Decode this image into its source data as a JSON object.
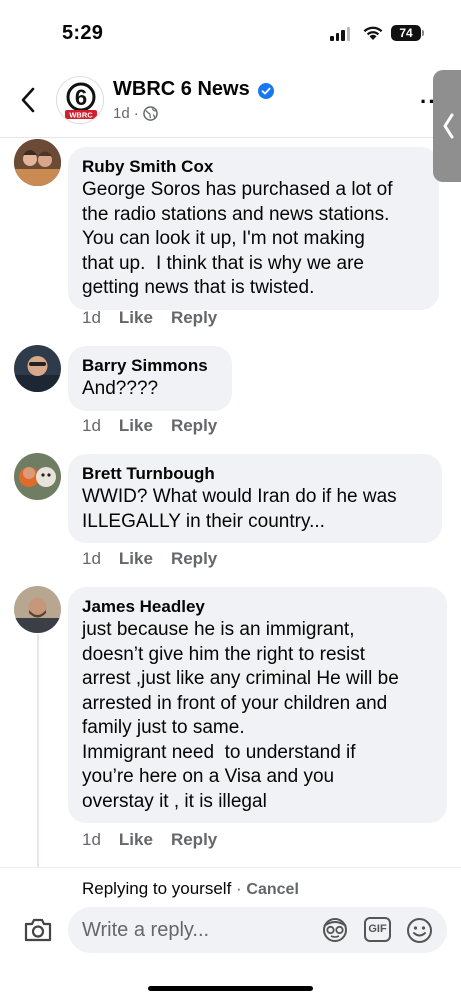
{
  "status": {
    "time": "5:29",
    "battery": "74"
  },
  "header": {
    "page_name": "WBRC 6 News",
    "meta_time": "1d",
    "meta_sep": "·",
    "logo_text": "WBRC",
    "logo_digit": "6"
  },
  "comments": [
    {
      "author": "Ruby Smith Cox",
      "text": "George Soros has purchased a lot of\nthe radio stations and news stations.\nYou can look it up, I'm not making\nthat up.  I think that is why we are\ngetting news that is twisted.",
      "time": "1d",
      "like": "Like",
      "reply": "Reply"
    },
    {
      "author": "Barry Simmons",
      "text": "And????",
      "time": "1d",
      "like": "Like",
      "reply": "Reply"
    },
    {
      "author": "Brett Turnbough",
      "text": "WWID? What would Iran do if he was\nILLEGALLY in their country...",
      "time": "1d",
      "like": "Like",
      "reply": "Reply"
    },
    {
      "author": "James Headley",
      "text": "just because he is an immigrant,\ndoesn’t give him the right to resist\narrest ,just like any criminal He will be\narrested in front of your children and\nfamily just to same.\nImmigrant need  to understand if\nyou’re here on a Visa and you\noverstay it , it is illegal",
      "time": "1d",
      "like": "Like",
      "reply": "Reply"
    }
  ],
  "reply_bar": {
    "replying_to": "Replying to yourself",
    "separator": " · ",
    "cancel": "Cancel",
    "placeholder": "Write a reply...",
    "gif": "GIF"
  },
  "colors": {
    "accent_verified": "#1877f2",
    "bubble_bg": "#f0f2f5",
    "secondary_text": "#65676b",
    "logo_red": "#d0202e"
  }
}
